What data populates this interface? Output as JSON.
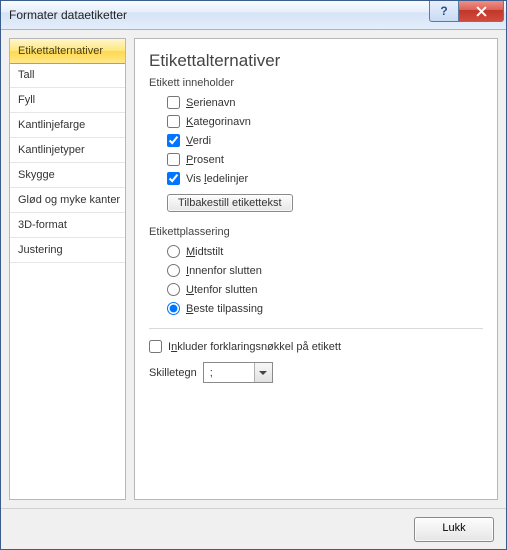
{
  "window": {
    "title": "Formater dataetiketter",
    "help_symbol": "?",
    "close_symbol": "X"
  },
  "sidebar": {
    "items": [
      {
        "label": "Etikettalternativer",
        "selected": true
      },
      {
        "label": "Tall",
        "selected": false
      },
      {
        "label": "Fyll",
        "selected": false
      },
      {
        "label": "Kantlinjefarge",
        "selected": false
      },
      {
        "label": "Kantlinjetyper",
        "selected": false
      },
      {
        "label": "Skygge",
        "selected": false
      },
      {
        "label": "Glød og myke kanter",
        "selected": false
      },
      {
        "label": "3D-format",
        "selected": false
      },
      {
        "label": "Justering",
        "selected": false
      }
    ]
  },
  "main": {
    "heading": "Etikettalternativer",
    "contains_group": {
      "label": "Etikett inneholder",
      "options": [
        {
          "text": "Serienavn",
          "accel_index": 0,
          "checked": false
        },
        {
          "text": "Kategorinavn",
          "accel_index": 0,
          "checked": false
        },
        {
          "text": "Verdi",
          "accel_index": 0,
          "checked": true
        },
        {
          "text": "Prosent",
          "accel_index": 0,
          "checked": false
        },
        {
          "text": "Vis ledelinjer",
          "accel_index": 4,
          "checked": true
        }
      ],
      "reset_button": "Tilbakestill etikettekst",
      "reset_accel_index": 0
    },
    "placement_group": {
      "label": "Etikettplassering",
      "options": [
        {
          "text": "Midtstilt",
          "accel_index": 0,
          "selected": false
        },
        {
          "text": "Innenfor slutten",
          "accel_index": 0,
          "selected": false
        },
        {
          "text": "Utenfor slutten",
          "accel_index": 0,
          "selected": false
        },
        {
          "text": "Beste tilpassing",
          "accel_index": 0,
          "selected": true
        }
      ]
    },
    "include_legend": {
      "text": "Inkluder forklaringsnøkkel på etikett",
      "accel_index": 1,
      "checked": false
    },
    "separator": {
      "label": "Skilletegn",
      "accel_index": 5,
      "value": ";"
    }
  },
  "footer": {
    "close": "Lukk"
  }
}
